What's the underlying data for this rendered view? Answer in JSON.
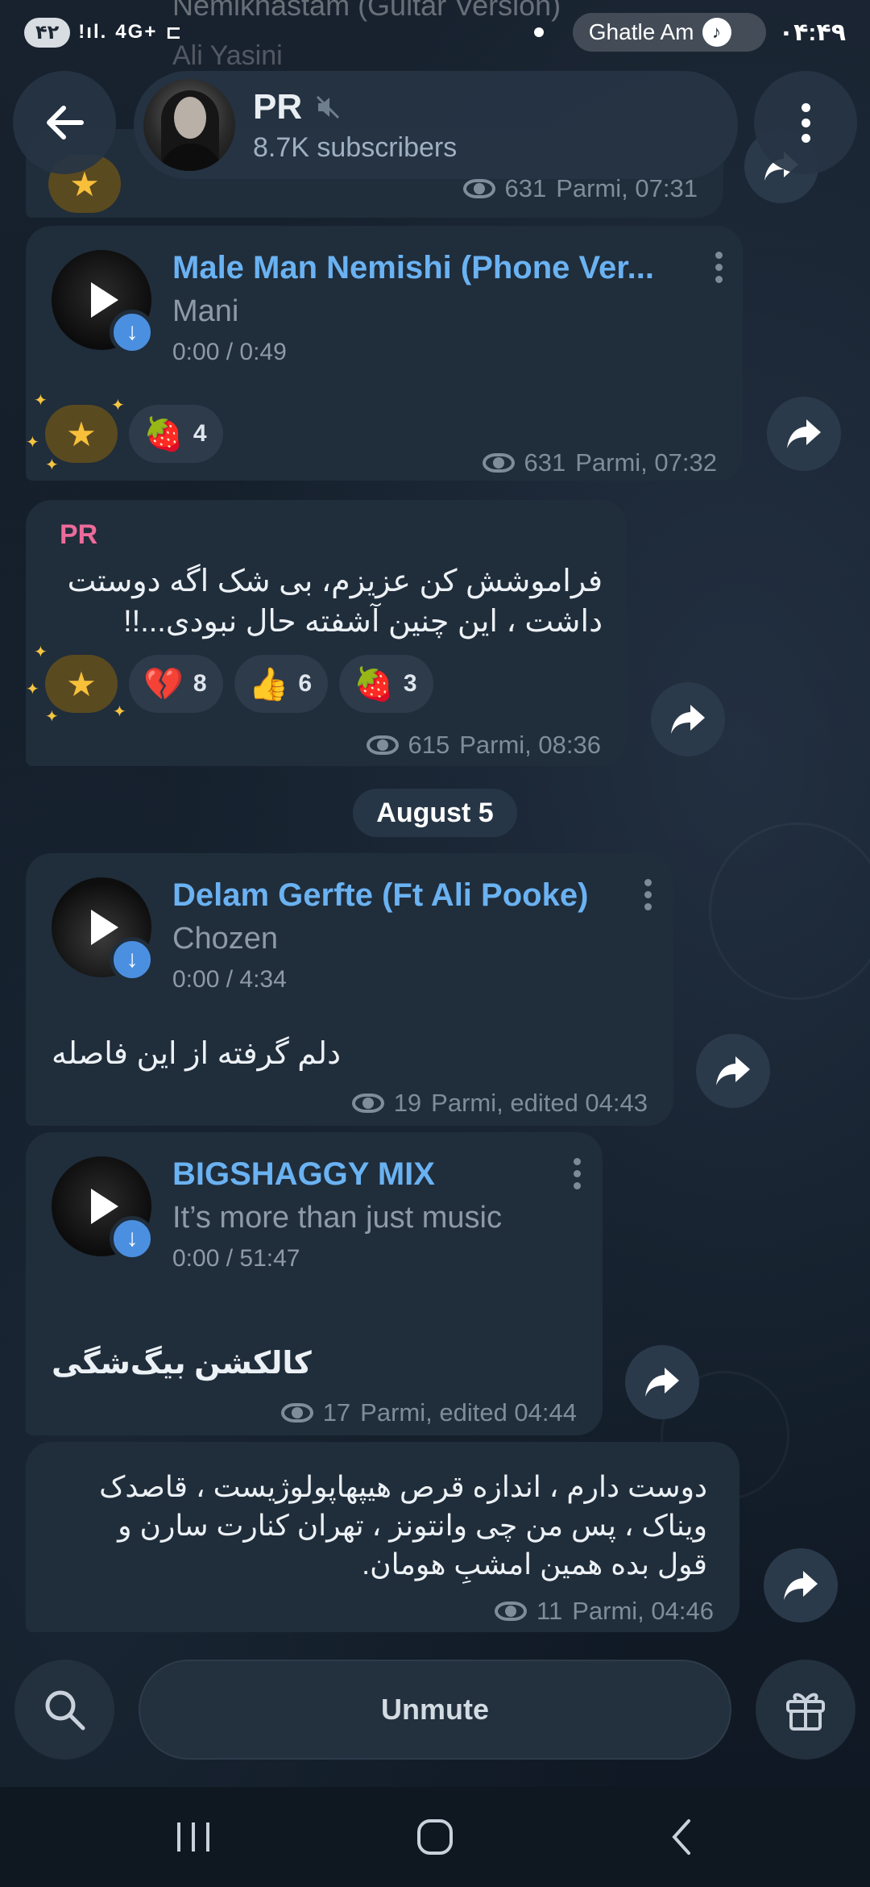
{
  "status_bar": {
    "left_badge": "۴۲",
    "network": "4G+",
    "media_title": "Ghatle Am",
    "time": "۰۴:۴۹"
  },
  "pinned": {
    "title": "Nemikhastam (Guitar Version)",
    "performer": "Ali Yasini"
  },
  "header": {
    "title": "PR",
    "subtitle": "8.7K subscribers"
  },
  "messages": [
    {
      "views": "631",
      "meta": "Parmi, 07:31"
    },
    {
      "title": "Male Man Nemishi (Phone Ver...",
      "performer": "Mani",
      "duration": "0:00 / 0:49",
      "reactions": [
        {
          "emoji": "🍓",
          "count": "4"
        }
      ],
      "views": "631",
      "meta": "Parmi, 07:32"
    },
    {
      "author": "PR",
      "text_line1": "فراموشش کن عزیزم، بی شک اگه دوستت",
      "text_line2": "داشت ، این چنین آشفته حال نبودی...!!",
      "reactions": [
        {
          "emoji": "💔",
          "count": "8"
        },
        {
          "emoji": "👍",
          "count": "6"
        },
        {
          "emoji": "🍓",
          "count": "3"
        }
      ],
      "views": "615",
      "meta": "Parmi, 08:36"
    },
    {
      "title": "Delam Gerfte (Ft Ali Pooke)",
      "performer": "Chozen",
      "duration": "0:00 / 4:34",
      "caption": "دلم گرفته از این فاصله",
      "views": "19",
      "meta": "Parmi, edited 04:43"
    },
    {
      "title": "BIGSHAGGY MIX",
      "performer": "It’s more than just music",
      "duration": "0:00 / 51:47",
      "caption": "کالکشن بیگ‌شگی",
      "views": "17",
      "meta": "Parmi, edited 04:44"
    },
    {
      "text_line1": "دوست دارم ، اندازه قرص هیپهاپولوژیست ، قاصدک",
      "text_line2": "ویناک ، پس من چی وانتونز ، تهران کنارت سارن و",
      "text_line3": "قول بده همین امشبِ هومان.",
      "views": "11",
      "meta": "Parmi, 04:46"
    }
  ],
  "date_separator": "August 5",
  "bottom": {
    "unmute_label": "Unmute"
  },
  "icons": {
    "back": "arrow-left-icon",
    "more": "more-vertical-icon",
    "muted": "speaker-muted-icon",
    "forward": "share-forward-icon",
    "search": "search-icon",
    "gift": "gift-icon"
  }
}
